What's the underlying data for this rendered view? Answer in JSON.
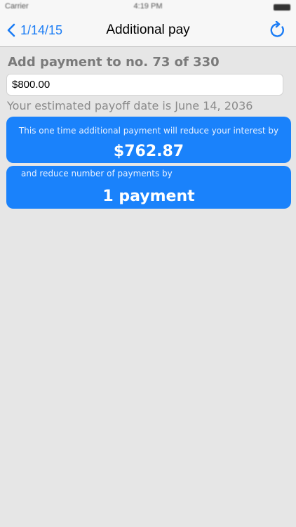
{
  "status_bar": {
    "carrier": "Carrier",
    "time": "4:19 PM"
  },
  "nav": {
    "back_label": "1/14/15",
    "title": "Additional pay",
    "back_icon": "chevron-left-icon",
    "refresh_icon": "refresh-icon",
    "accent_color": "#1a7cf5"
  },
  "main": {
    "heading": "Add payment to no. 73 of 330",
    "amount_value": "$800.00",
    "payoff_text": "Your estimated payoff date is June 14, 2036"
  },
  "cards": {
    "interest_caption": "This one time additional payment will reduce your interest by",
    "interest_value": "$762.87",
    "payments_caption": "and reduce number of payments by",
    "payments_value": "1 payment",
    "card_color": "#1a82fb"
  }
}
